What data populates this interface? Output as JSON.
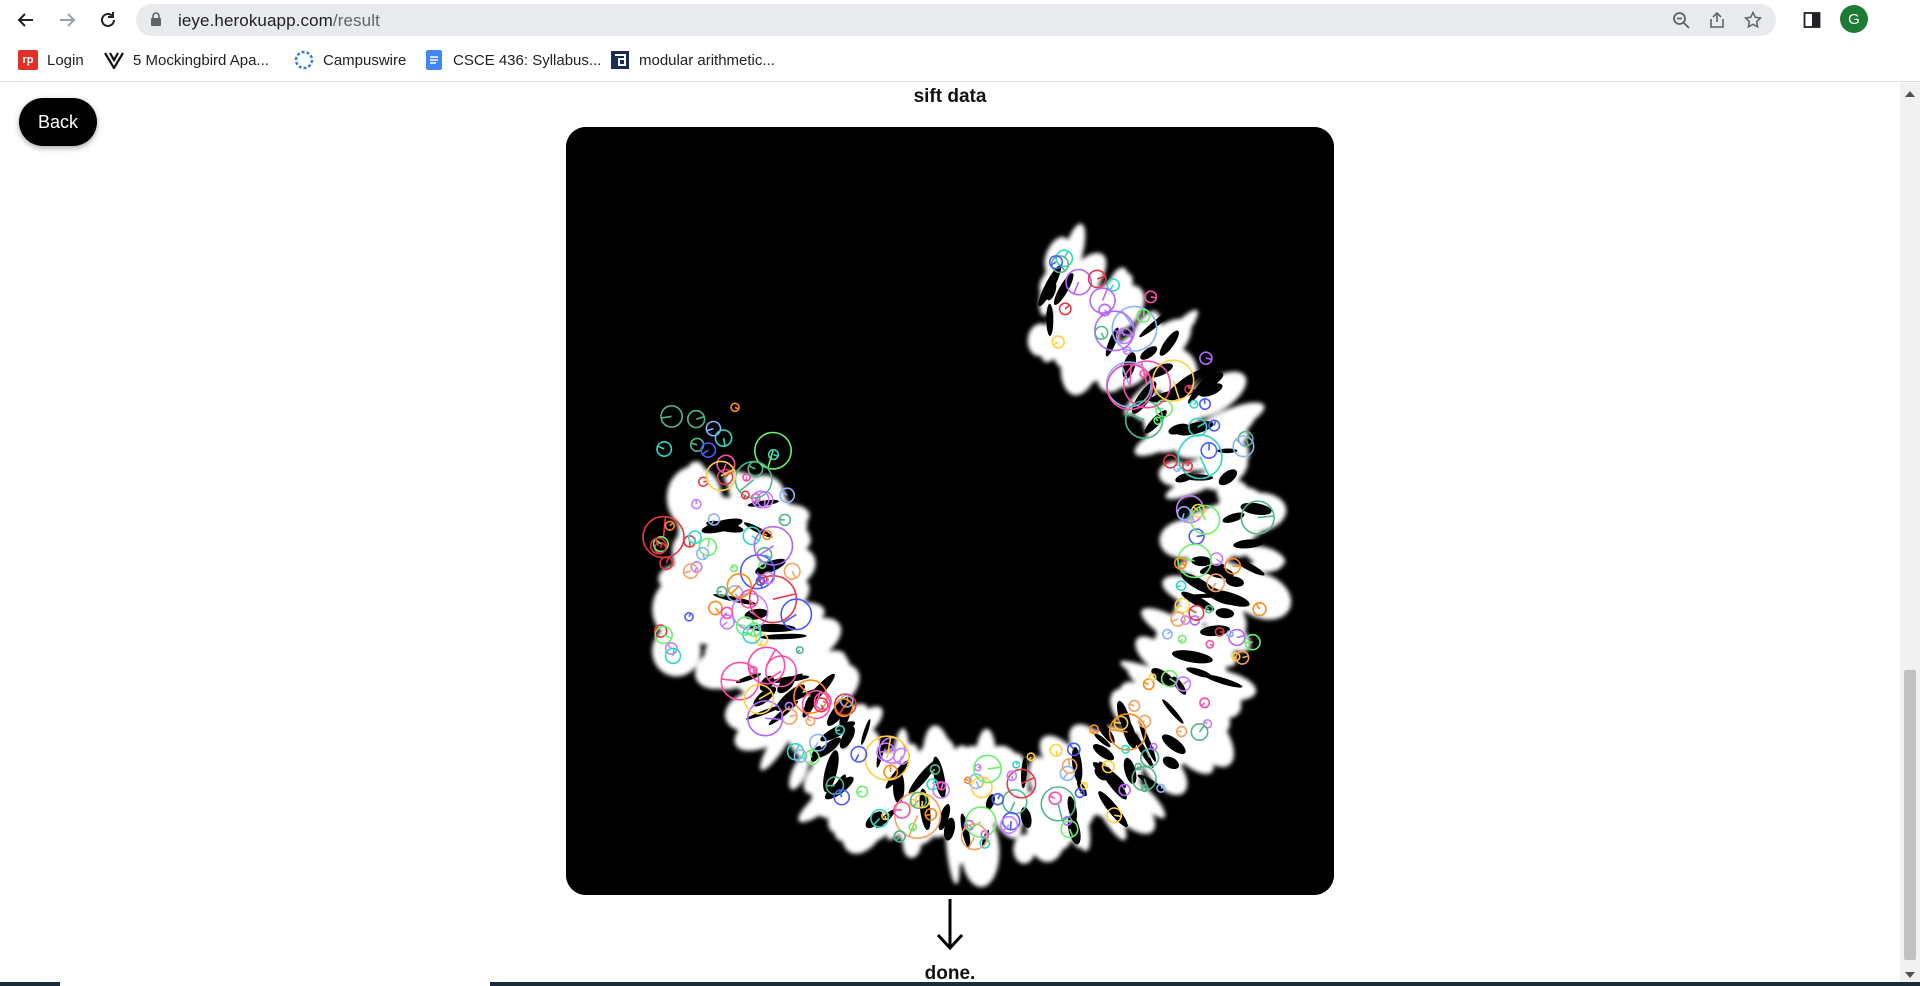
{
  "browser": {
    "url_host": "ieye.herokuapp.com",
    "url_path": "/result",
    "profile_initial": "G"
  },
  "bookmarks": [
    {
      "label": "Login",
      "icon": "rp"
    },
    {
      "label": "5 Mockingbird Apa...",
      "icon": "v-logo-icon"
    },
    {
      "label": "Campuswire",
      "icon": "campuswire-icon"
    },
    {
      "label": "CSCE 436: Syllabus...",
      "icon": "docs-icon"
    },
    {
      "label": "modular arithmetic...",
      "icon": "modular-icon"
    }
  ],
  "page": {
    "back_label": "Back",
    "section_title": "sift data",
    "done_label": "done."
  },
  "colors": {
    "button_bg": "#000000",
    "avatar_bg": "#1e7b34"
  }
}
